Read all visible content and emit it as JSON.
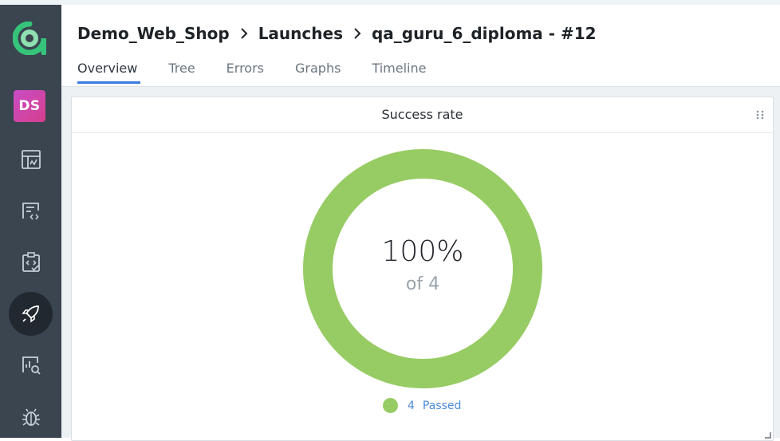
{
  "sidebar": {
    "avatar_initials": "DS",
    "icons": [
      "dashboard-icon",
      "testcases-icon",
      "testplans-icon",
      "launches-icon",
      "analytics-icon",
      "defects-icon"
    ],
    "active_item": "launches-icon"
  },
  "breadcrumb": {
    "project": "Demo_Web_Shop",
    "section": "Launches",
    "launch": "qa_guru_6_diploma - #12"
  },
  "tabs": [
    "Overview",
    "Tree",
    "Errors",
    "Graphs",
    "Timeline"
  ],
  "active_tab": "Overview",
  "widget": {
    "title": "Success rate",
    "percent": "100%",
    "of_total": "of 4",
    "legend": {
      "count": "4",
      "label": "Passed"
    }
  },
  "colors": {
    "passed": "#97cc64",
    "sidebar": "#3a4550",
    "accent": "#3a7be0",
    "logo": "#36c37a",
    "avatar": "#c94cc6"
  },
  "chart_data": {
    "type": "pie",
    "categories": [
      "Passed"
    ],
    "values": [
      4
    ]
  }
}
